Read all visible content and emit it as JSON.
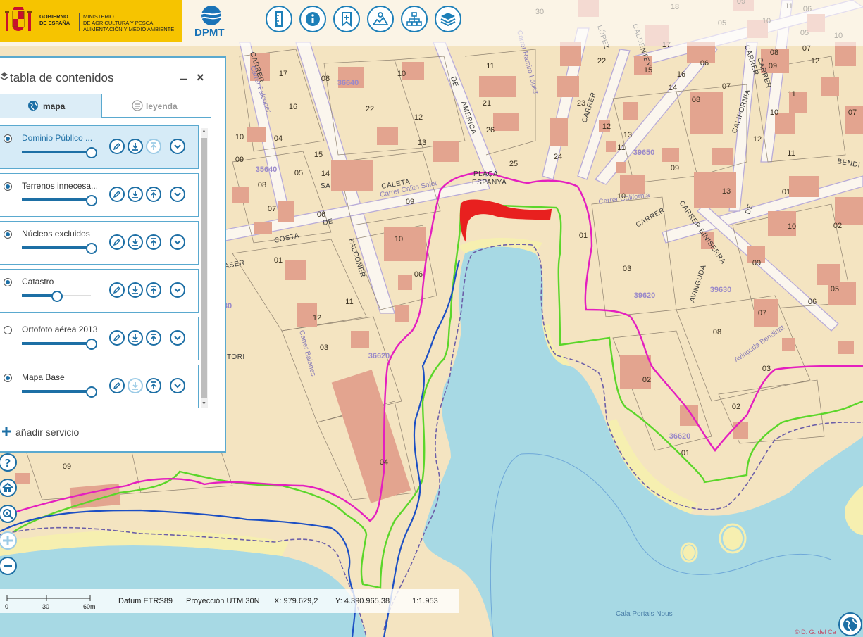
{
  "header": {
    "gov_line1": "GOBIERNO",
    "gov_line2": "DE ESPAÑA",
    "ministry_line1": "MINISTERIO",
    "ministry_line2": "DE AGRICULTURA Y PESCA,",
    "ministry_line3": "ALIMENTACIÓN Y MEDIO AMBIENTE",
    "dpmt_logo": "DPMT",
    "toolbar_icons": [
      "ruler-icon",
      "info-icon",
      "bookmark-icon",
      "map-profile-icon",
      "sitemap-icon",
      "layers-icon"
    ],
    "brand_color": "#f6c400",
    "accent_color": "#1d7fb8"
  },
  "panel": {
    "title": "tabla de contenidos",
    "minimize": "–",
    "close": "×",
    "tabs": [
      {
        "label": "mapa",
        "active": true
      },
      {
        "label": "leyenda",
        "active": false
      }
    ],
    "layers": [
      {
        "name": "Dominio Público ...",
        "checked": true,
        "selected": true,
        "opacity": 1.0
      },
      {
        "name": "Terrenos innecesa...",
        "checked": true,
        "selected": false,
        "opacity": 1.0
      },
      {
        "name": "Núcleos excluidos",
        "checked": true,
        "selected": false,
        "opacity": 1.0
      },
      {
        "name": "Catastro",
        "checked": true,
        "selected": false,
        "opacity": 0.5
      },
      {
        "name": "Ortofoto aérea 2013",
        "checked": false,
        "selected": false,
        "opacity": 1.0
      },
      {
        "name": "Mapa Base",
        "checked": true,
        "selected": false,
        "opacity": 1.0
      }
    ],
    "add_service": "añadir servicio"
  },
  "map": {
    "plot_labels": [
      "17",
      "16",
      "10",
      "08",
      "11",
      "22",
      "12",
      "21",
      "26",
      "13",
      "25",
      "24",
      "23",
      "22",
      "15",
      "14",
      "13",
      "15",
      "17",
      "06",
      "07",
      "08",
      "12",
      "10",
      "11",
      "14",
      "08",
      "10",
      "11",
      "12",
      "13",
      "01",
      "02",
      "09",
      "10",
      "03",
      "04",
      "05",
      "06",
      "07",
      "09",
      "10",
      "01",
      "11",
      "12",
      "03",
      "04",
      "06",
      "08",
      "05",
      "01",
      "02",
      "03",
      "06",
      "07",
      "08",
      "09",
      "01",
      "13",
      "11",
      "12",
      "20",
      "30",
      "18",
      "09"
    ],
    "cadastre_labels": [
      "36640",
      "35640",
      "39650",
      "39630",
      "36620",
      "39620",
      "36620",
      "36630"
    ],
    "streets": [
      "Carrer Falconer",
      "CARRER",
      "FALCONER",
      "DE",
      "SA",
      "COSTA",
      "CALETA",
      "Carrer Calito Solet",
      "PLAÇA",
      "ESPANYA",
      "DE",
      "AMÈRICA",
      "Carrer Ramiro López",
      "LÓPEZ",
      "CALDENTEY",
      "CARRER",
      "CALIFORNIA",
      "CARRER",
      "Carrer California",
      "CARRER",
      "BINISERRA",
      "AVINGUDA",
      "DE",
      "Avinguda Bendinat",
      "BENDINAT",
      "Carrer Balanes",
      "BALANES"
    ],
    "sea_label": "Cala Portals Nous",
    "line_colors": {
      "zone_limit": "#e41fbf",
      "dpmt_boundary": "#5bd62a",
      "coastline_blue": "#1c4fc4",
      "shore_deslinde": "#6c5fa8",
      "highlight": "#e8201f"
    }
  },
  "nav_controls": [
    "help-icon",
    "home-icon",
    "zoom-in-icon",
    "pan-icon",
    "zoom-out-icon"
  ],
  "status": {
    "scale_ticks": [
      "0",
      "30",
      "60m"
    ],
    "datum": "Datum ETRS89",
    "projection": "Proyección UTM 30N",
    "x": "X: 979.629,2",
    "y": "Y: 4.390.965,38",
    "scale": "1:1.953"
  },
  "attribution": "© D. G. del Ca"
}
